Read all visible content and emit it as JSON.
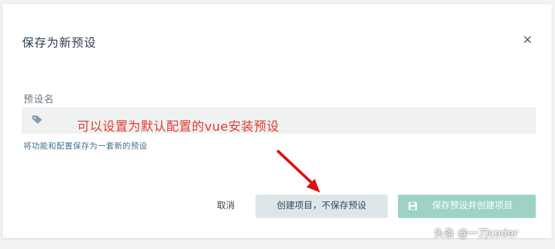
{
  "dialog": {
    "title": "保存为新预设",
    "close_glyph": "×",
    "field_label": "预设名",
    "input_value": "",
    "input_icon": "tag-icon",
    "annotation": "可以设置为默认配置的vue安装预设",
    "annotation_color": "#e23a2e",
    "hint": "将功能和配置保存为一套新的预设"
  },
  "buttons": {
    "cancel_label": "取消",
    "create_label": "创建项目，不保存预设",
    "save_label": "保存预设并创建项目",
    "save_icon": "floppy-disk-icon"
  },
  "colors": {
    "accent": "#42b983",
    "save_button_disabled": "#9dd2c4",
    "secondary_button": "#dde7e9"
  },
  "watermark": "头条 @一刀coder"
}
